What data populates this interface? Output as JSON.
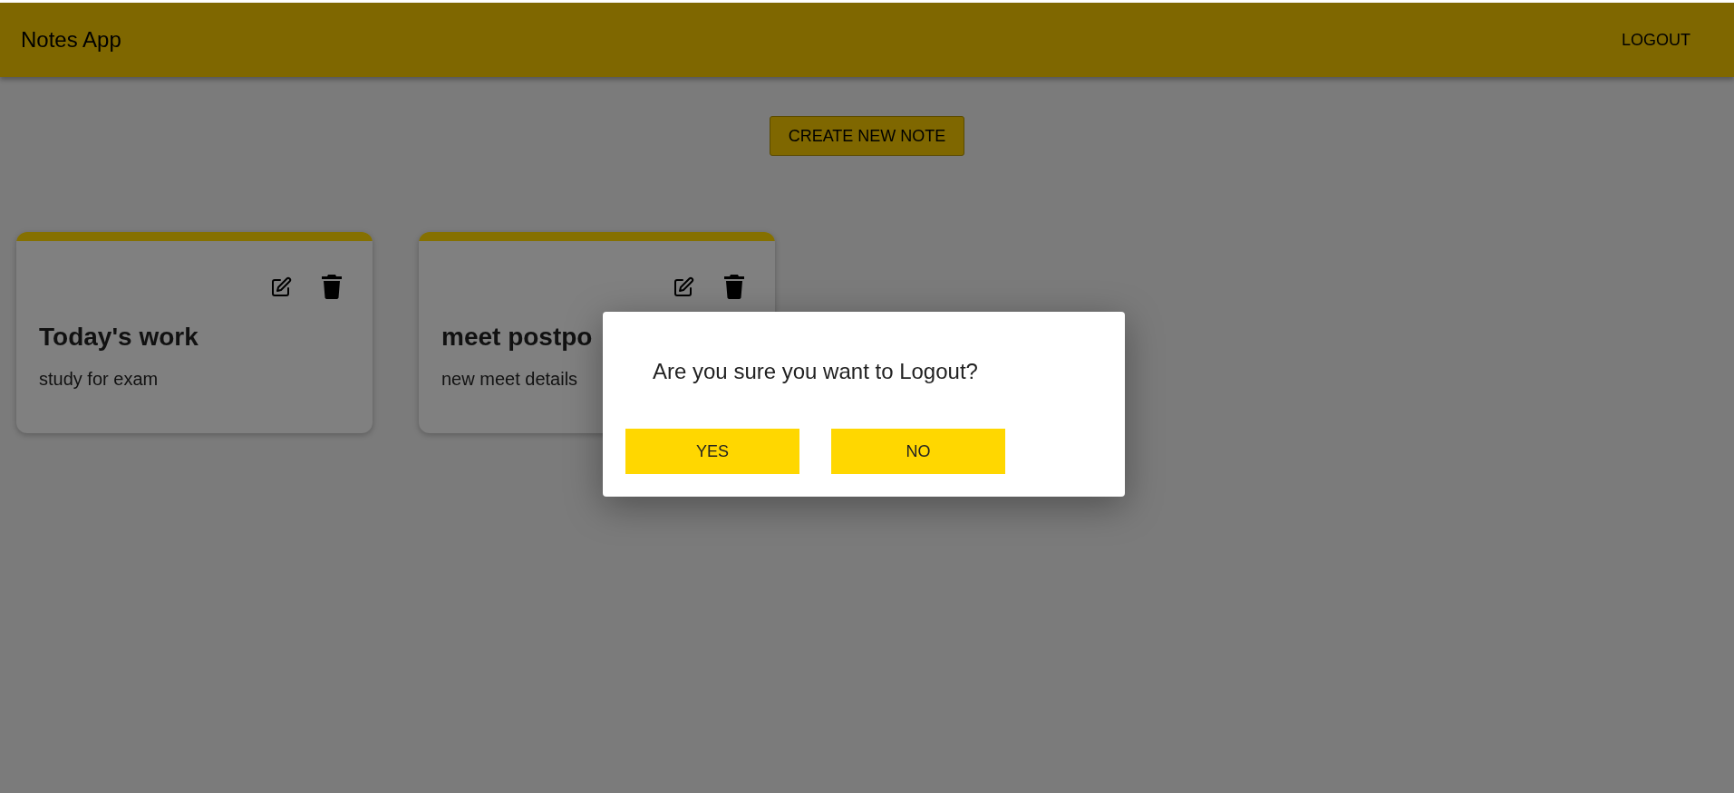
{
  "app_bar": {
    "title": "Notes App",
    "logout": "LOGOUT"
  },
  "create_button": "CREATE NEW NOTE",
  "notes": [
    {
      "title": "Today's work",
      "body": "study for exam"
    },
    {
      "title": "meet postpo",
      "body": "new meet details"
    }
  ],
  "dialog": {
    "message": "Are you sure you want to Logout?",
    "buttons": [
      "YES",
      "NO"
    ]
  }
}
